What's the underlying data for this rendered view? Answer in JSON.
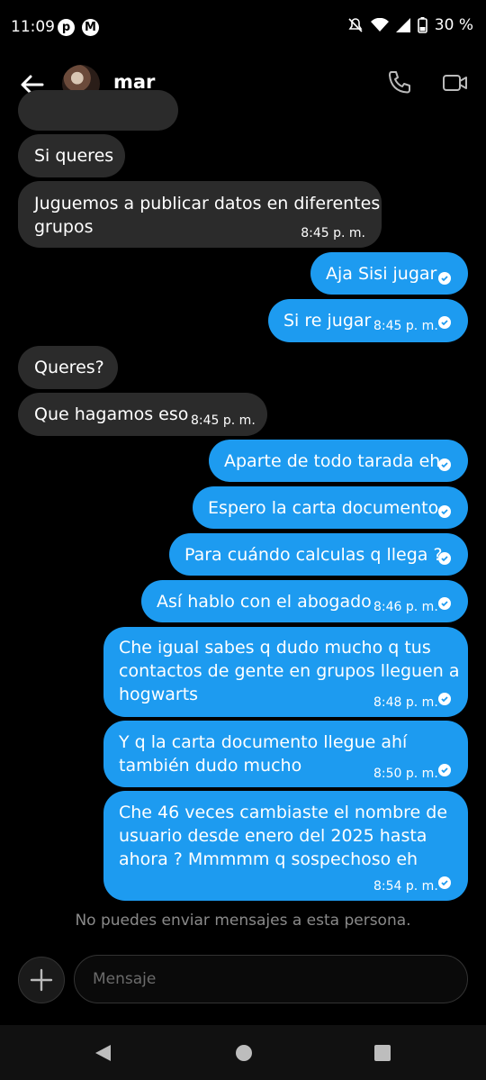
{
  "status": {
    "time": "11:09",
    "battery": "30 %"
  },
  "header": {
    "contact_name": "mar"
  },
  "messages": [
    {
      "text": "Si queres"
    },
    {
      "text": "Juguemos a publicar datos en diferentes\ngrupos",
      "time": "8:45 p. m."
    },
    {
      "text": "Aja Sisi jugar"
    },
    {
      "text": "Si re jugar",
      "time": "8:45 p. m."
    },
    {
      "text": "Queres?"
    },
    {
      "text": "Que hagamos eso",
      "time": "8:45 p. m."
    },
    {
      "text": "Aparte de todo tarada eh"
    },
    {
      "text": "Espero la carta documento"
    },
    {
      "text": "Para cuándo calculas q llega ?"
    },
    {
      "text": "Así hablo con el abogado",
      "time": "8:46 p. m."
    },
    {
      "text": "Che igual sabes q dudo mucho q tus\ncontactos de gente en grupos lleguen a\nhogwarts",
      "time": "8:48 p. m."
    },
    {
      "text": "Y q la carta documento llegue ahí\ntambién dudo mucho",
      "time": "8:50 p. m."
    },
    {
      "text": "Che 46 veces cambiaste el nombre de\nusuario desde enero del 2025 hasta\nahora ? Mmmmm q sospechoso eh",
      "time": "8:54 p. m."
    }
  ],
  "notice": "No puedes enviar mensajes a esta persona.",
  "composer": {
    "placeholder": "Mensaje"
  },
  "colors": {
    "outgoing": "#1d9bf0",
    "incoming": "#2b2b2b",
    "background": "#000000"
  }
}
